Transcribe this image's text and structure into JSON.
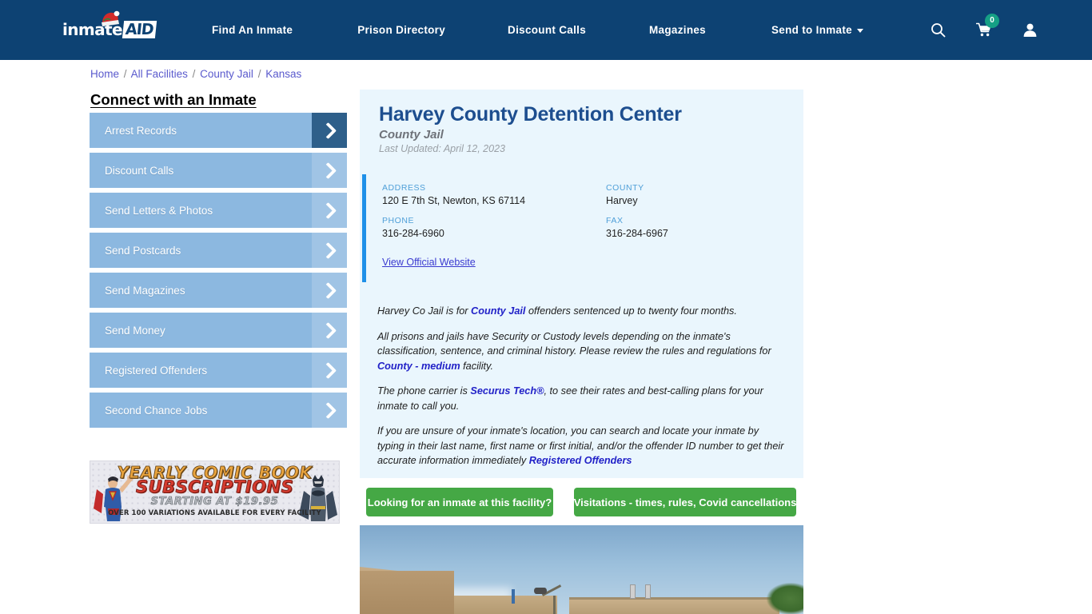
{
  "header": {
    "logo": {
      "part1": "inmate",
      "part2": "AID",
      "icon": "santa-hat-icon"
    },
    "nav": [
      {
        "label": "Find An Inmate"
      },
      {
        "label": "Prison Directory"
      },
      {
        "label": "Discount Calls"
      },
      {
        "label": "Magazines"
      },
      {
        "label": "Send to Inmate"
      }
    ],
    "icons": {
      "search": "search-icon",
      "cart": "cart-icon",
      "cart_badge": "0",
      "account": "user-account-icon"
    },
    "background_color": "#0d4273"
  },
  "breadcrumb": {
    "items": [
      {
        "label": "Home"
      },
      {
        "label": "All Facilities"
      },
      {
        "label": "County Jail"
      },
      {
        "label": "Kansas"
      }
    ],
    "separator": "/"
  },
  "sidebar": {
    "title": "Connect with an Inmate",
    "items": [
      {
        "label": "Arrest Records"
      },
      {
        "label": "Discount Calls"
      },
      {
        "label": "Send Letters & Photos"
      },
      {
        "label": "Send Postcards"
      },
      {
        "label": "Send Magazines"
      },
      {
        "label": "Send Money"
      },
      {
        "label": "Registered Offenders"
      },
      {
        "label": "Second Chance Jobs"
      }
    ],
    "button_color": "#8cb8e0",
    "active_arrow_color": "#2e5f8a"
  },
  "ad": {
    "line1": "YEARLY COMIC BOOK",
    "line2": "SUBSCRIPTIONS",
    "line3": "STARTING AT $19.95",
    "line4": "OVER 100 VARIATIONS AVAILABLE FOR EVERY FACILITY"
  },
  "facility": {
    "name": "Harvey County Detention Center",
    "type": "County Jail",
    "last_updated": "Last Updated: April 12, 2023",
    "info": [
      {
        "label": "ADDRESS",
        "value": "120 E 7th St, Newton, KS 67114"
      },
      {
        "label": "COUNTY",
        "value": "Harvey"
      },
      {
        "label": "PHONE",
        "value": "316-284-6960"
      },
      {
        "label": "FAX",
        "value": "316-284-6967"
      }
    ],
    "official_website_link": "View Official Website",
    "accent_color": "#1e90e8",
    "card_background": "#eaf6fd",
    "description": [
      {
        "parts": [
          {
            "text": "Harvey Co Jail is for ",
            "link": false
          },
          {
            "text": "County Jail",
            "link": true
          },
          {
            "text": " offenders sentenced up to twenty four months.",
            "link": false
          }
        ]
      },
      {
        "parts": [
          {
            "text": "All prisons and jails have Security or Custody levels depending on the inmate's classification, sentence, and criminal history. Please review the rules and regulations for ",
            "link": false
          },
          {
            "text": "County - medium",
            "link": true
          },
          {
            "text": " facility.",
            "link": false
          }
        ]
      },
      {
        "parts": [
          {
            "text": "The phone carrier is ",
            "link": false
          },
          {
            "text": "Securus Tech®",
            "link": true
          },
          {
            "text": ", to see their rates and best-calling plans for your inmate to call you.",
            "link": false
          }
        ]
      },
      {
        "parts": [
          {
            "text": "If you are unsure of your inmate's location, you can search and locate your inmate by typing in their last name, first name or first initial, and/or the offender ID number to get their accurate information immediately ",
            "link": false
          },
          {
            "text": "Registered Offenders",
            "link": true
          }
        ]
      }
    ]
  },
  "actions": {
    "inmate_search_label": "Looking for an inmate at this facility?",
    "visitations_label": "Visitations - times, rules, Covid cancellations",
    "button_color": "#45a845"
  },
  "photo": {
    "alt": "Harvey County Detention Center building exterior"
  }
}
